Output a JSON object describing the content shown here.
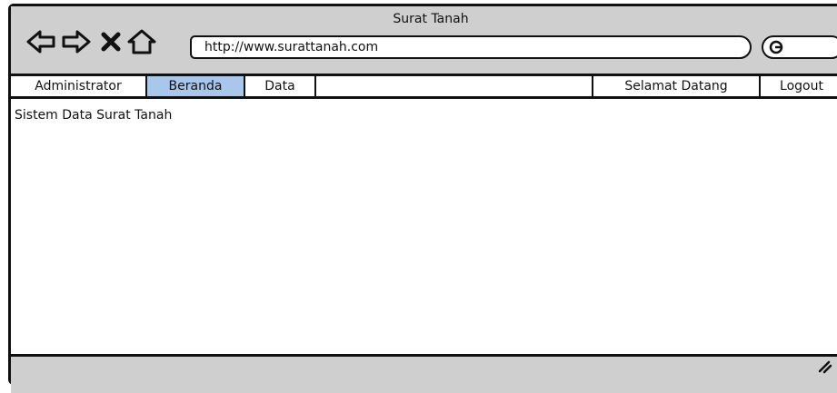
{
  "window": {
    "title": "Surat Tanah"
  },
  "toolbar": {
    "back_icon": "back-arrow-icon",
    "forward_icon": "forward-arrow-icon",
    "stop_icon": "close-icon",
    "home_icon": "home-icon",
    "url": "http://www.surattanah.com",
    "search_icon": "search-icon"
  },
  "menu": {
    "items": [
      {
        "label": "Administrator"
      },
      {
        "label": "Beranda",
        "active": true
      },
      {
        "label": "Data"
      },
      {
        "label": ""
      },
      {
        "label": "Selamat Datang"
      },
      {
        "label": "Logout"
      }
    ]
  },
  "content": {
    "heading": "Sistem Data Surat Tanah"
  },
  "colors": {
    "chrome": "#cfcfcf",
    "active_tab": "#a9c7ea",
    "stroke": "#111111"
  }
}
